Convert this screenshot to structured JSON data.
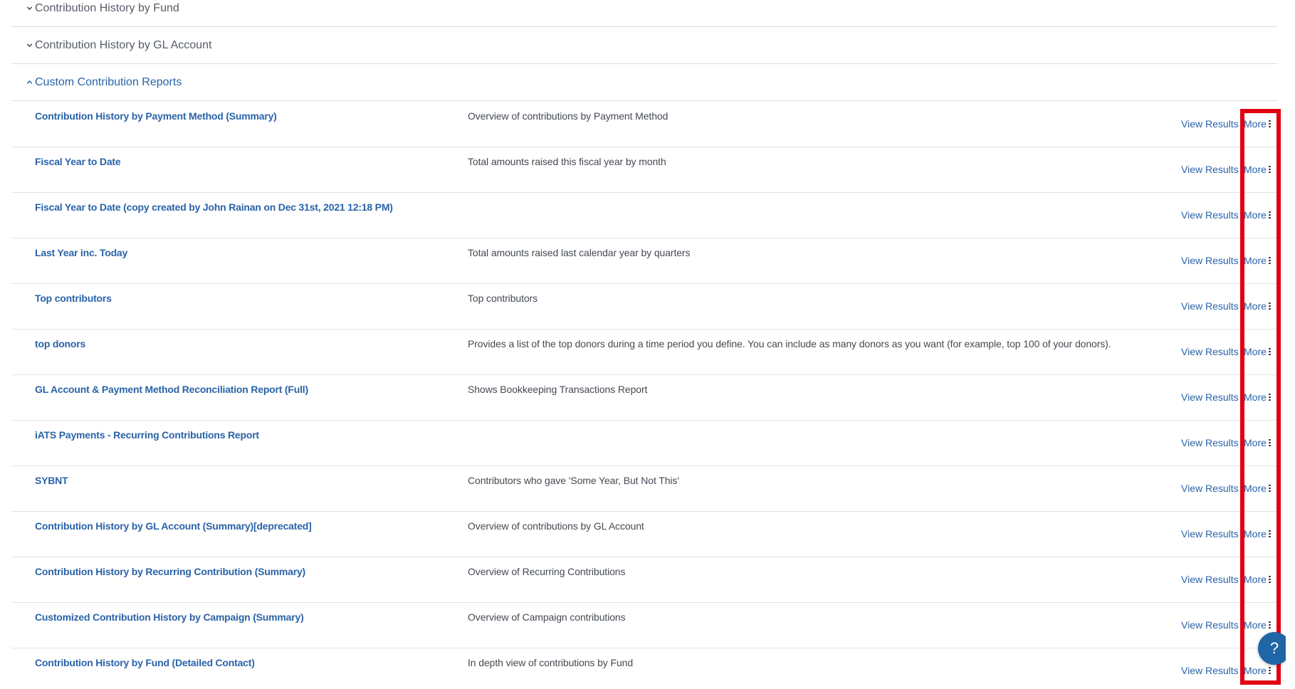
{
  "accordion": [
    {
      "title": "Contribution History by Fund",
      "state": "collapsed"
    },
    {
      "title": "Contribution History by GL Account",
      "state": "collapsed"
    },
    {
      "title": "Custom Contribution Reports",
      "state": "expanded"
    }
  ],
  "actions": {
    "view_results_label": "View Results",
    "more_label": "More"
  },
  "reports": [
    {
      "name": "Contribution History by Payment Method (Summary)",
      "description": "Overview of contributions by Payment Method"
    },
    {
      "name": "Fiscal Year to Date",
      "description": "Total amounts raised this fiscal year by month"
    },
    {
      "name": "Fiscal Year to Date (copy created by John Rainan on Dec 31st, 2021 12:18 PM)",
      "description": ""
    },
    {
      "name": "Last Year inc. Today",
      "description": "Total amounts raised last calendar year by quarters"
    },
    {
      "name": "Top contributors",
      "description": "Top contributors"
    },
    {
      "name": "top donors",
      "description": "Provides a list of the top donors during a time period you define. You can include as many donors as you want (for example, top 100 of your donors)."
    },
    {
      "name": "GL Account & Payment Method Reconciliation Report (Full)",
      "description": "Shows Bookkeeping Transactions Report"
    },
    {
      "name": "iATS Payments - Recurring Contributions Report",
      "description": ""
    },
    {
      "name": "SYBNT",
      "description": "Contributors who gave 'Some Year, But Not This'"
    },
    {
      "name": "Contribution History by GL Account (Summary)[deprecated]",
      "description": "Overview of contributions by GL Account"
    },
    {
      "name": "Contribution History by Recurring Contribution (Summary)",
      "description": "Overview of Recurring Contributions"
    },
    {
      "name": "Customized Contribution History by Campaign (Summary)",
      "description": "Overview of Campaign contributions"
    },
    {
      "name": "Contribution History by Fund (Detailed Contact)",
      "description": "In depth view of contributions by Fund"
    }
  ],
  "help": {
    "label": "?"
  },
  "colors": {
    "link": "#2a63a8",
    "highlight": "#e00012",
    "help_button": "#1f66a6"
  }
}
